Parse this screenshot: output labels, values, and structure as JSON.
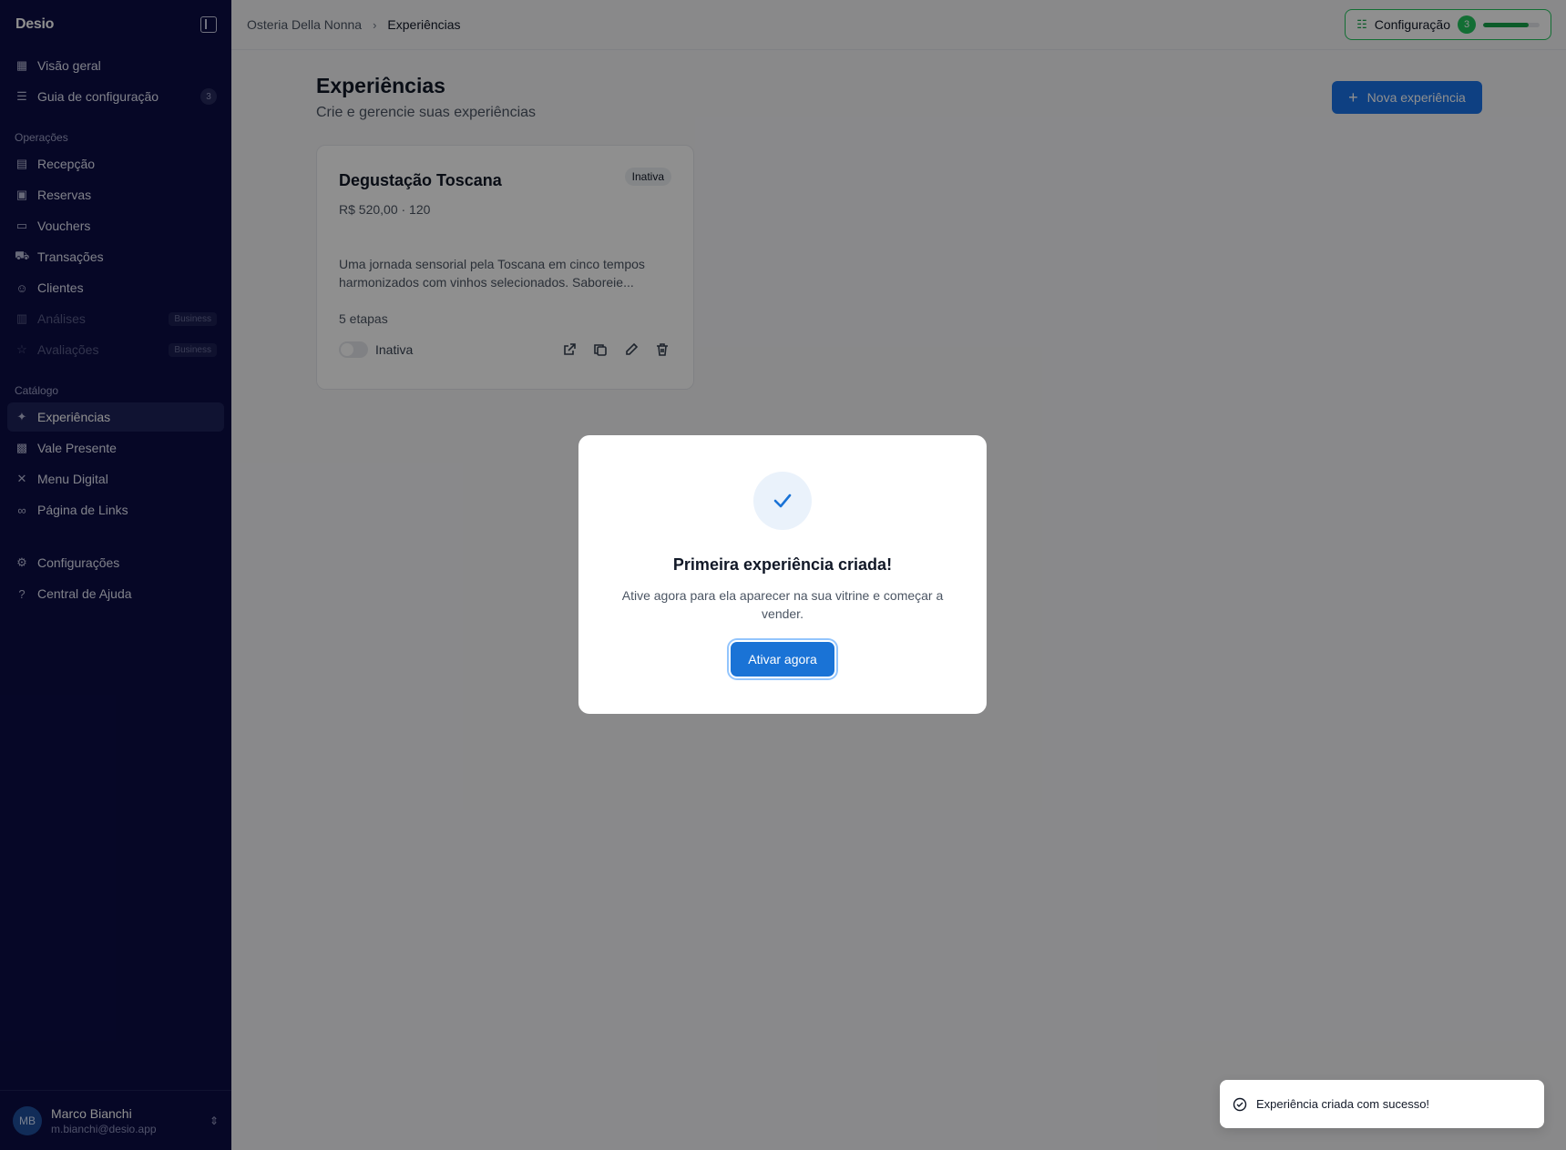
{
  "sidebar": {
    "logo": "Desio",
    "top_items": [
      {
        "label": "Visão geral",
        "icon": "dashboard-icon"
      },
      {
        "label": "Guia de configuração",
        "icon": "checklist-icon",
        "badge": "3"
      }
    ],
    "operations_title": "Operações",
    "operations": [
      {
        "label": "Recepção",
        "icon": "clipboard-icon"
      },
      {
        "label": "Reservas",
        "icon": "calendar-icon"
      },
      {
        "label": "Vouchers",
        "icon": "ticket-icon"
      },
      {
        "label": "Transações",
        "icon": "cart-icon"
      },
      {
        "label": "Clientes",
        "icon": "users-icon"
      },
      {
        "label": "Análises",
        "icon": "chart-icon",
        "badge": "Business",
        "disabled": true
      },
      {
        "label": "Avaliações",
        "icon": "star-icon",
        "badge": "Business",
        "disabled": true
      }
    ],
    "catalog_title": "Catálogo",
    "catalog": [
      {
        "label": "Experiências",
        "icon": "sparkles-icon",
        "active": true
      },
      {
        "label": "Vale Presente",
        "icon": "gift-icon"
      },
      {
        "label": "Menu Digital",
        "icon": "utensils-icon"
      },
      {
        "label": "Página de Links",
        "icon": "link-icon"
      }
    ],
    "bottom_items": [
      {
        "label": "Configurações",
        "icon": "gear-icon"
      },
      {
        "label": "Central de Ajuda",
        "icon": "help-icon"
      }
    ],
    "user": {
      "initials": "MB",
      "name": "Marco Bianchi",
      "email": "m.bianchi@desio.app"
    }
  },
  "topbar": {
    "breadcrumb_root": "Osteria Della Nonna",
    "breadcrumb_current": "Experiências",
    "setup_label": "Configuração",
    "setup_count": "3",
    "setup_progress": 0.8
  },
  "main": {
    "title": "Experiências",
    "subtitle": "Crie e gerencie suas experiências",
    "new_button": "Nova experiência",
    "card": {
      "title": "Degustação Toscana",
      "status": "Inativa",
      "price": "R$ 520,00 · 120",
      "description": "Uma jornada sensorial pela Toscana em cinco tempos harmonizados com vinhos selecionados. Saboreie...",
      "steps": "5 etapas",
      "toggle_label": "Inativa"
    }
  },
  "modal": {
    "title": "Primeira experiência criada!",
    "text": "Ative agora para ela aparecer na sua vitrine e começar a vender.",
    "button": "Ativar agora"
  },
  "toast": {
    "text": "Experiência criada com sucesso!"
  },
  "colors": {
    "sidebar_bg": "#0b0d45",
    "primary": "#1a73e8",
    "success": "#22c55e"
  }
}
